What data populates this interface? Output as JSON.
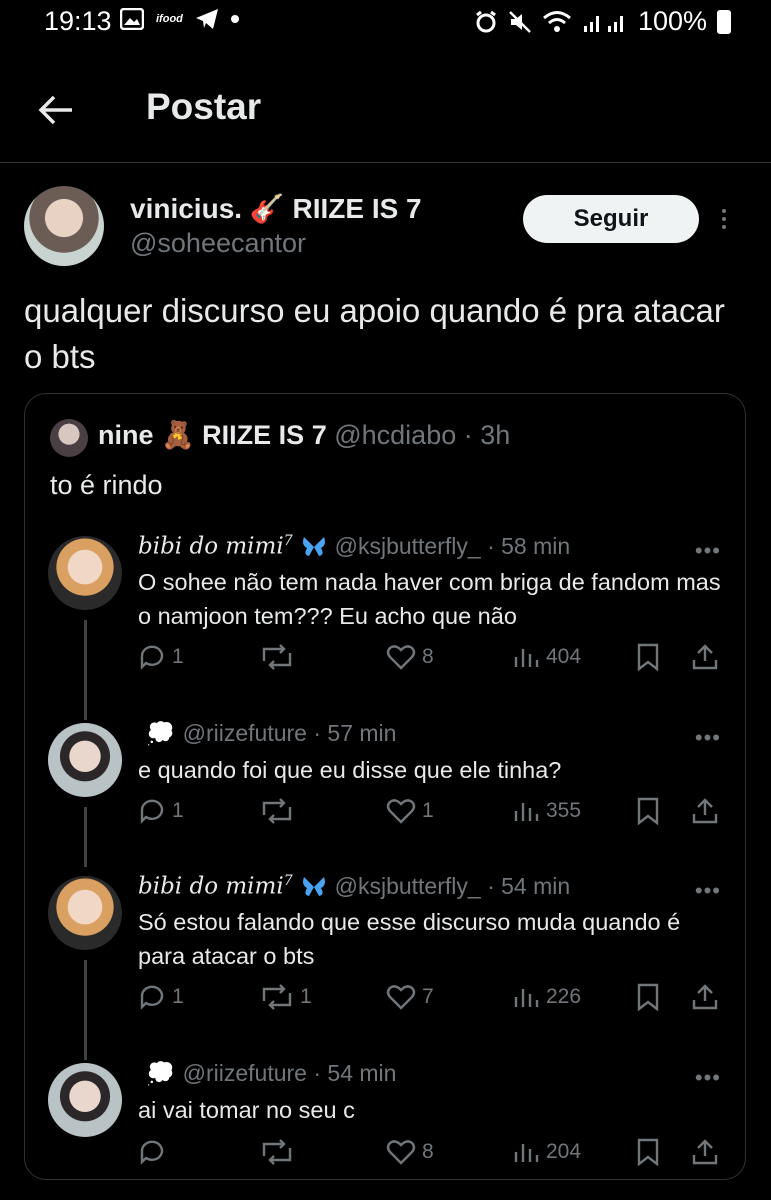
{
  "status_bar": {
    "time": "19:13",
    "app_tag": "ifood",
    "battery": "100%"
  },
  "header": {
    "title": "Postar"
  },
  "post": {
    "author_name": "vinicius.",
    "author_suffix": "RIIZE IS 7",
    "author_handle": "@soheecantor",
    "follow_label": "Seguir",
    "text": "qualquer discurso eu apoio quando é pra atacar o bts"
  },
  "quote": {
    "name": "nine",
    "suffix": "RIIZE IS 7",
    "meta": "@hcdiabo · 3h",
    "text": "to é rindo"
  },
  "replies": [
    {
      "name": "bibi do mimi",
      "sup": "7",
      "meta": "@ksjbutterfly_ · 58 min",
      "text": "O sohee não tem nada haver com briga de fandom mas o namjoon tem??? Eu acho que não",
      "replies": "1",
      "reposts": "",
      "likes": "8",
      "views": "404"
    },
    {
      "name": "",
      "sup": "",
      "meta": "@riizefuture · 57 min",
      "text": "e quando foi que eu disse que ele tinha?",
      "replies": "1",
      "reposts": "",
      "likes": "1",
      "views": "355"
    },
    {
      "name": "bibi do mimi",
      "sup": "7",
      "meta": "@ksjbutterfly_ · 54 min",
      "text": "Só estou falando que esse discurso muda quando é para atacar o bts",
      "replies": "1",
      "reposts": "1",
      "likes": "7",
      "views": "226"
    },
    {
      "name": "",
      "sup": "",
      "meta": "@riizefuture · 54 min",
      "text": "ai vai tomar no seu c",
      "replies": "",
      "reposts": "",
      "likes": "8",
      "views": "204"
    }
  ],
  "more_label": "•••"
}
